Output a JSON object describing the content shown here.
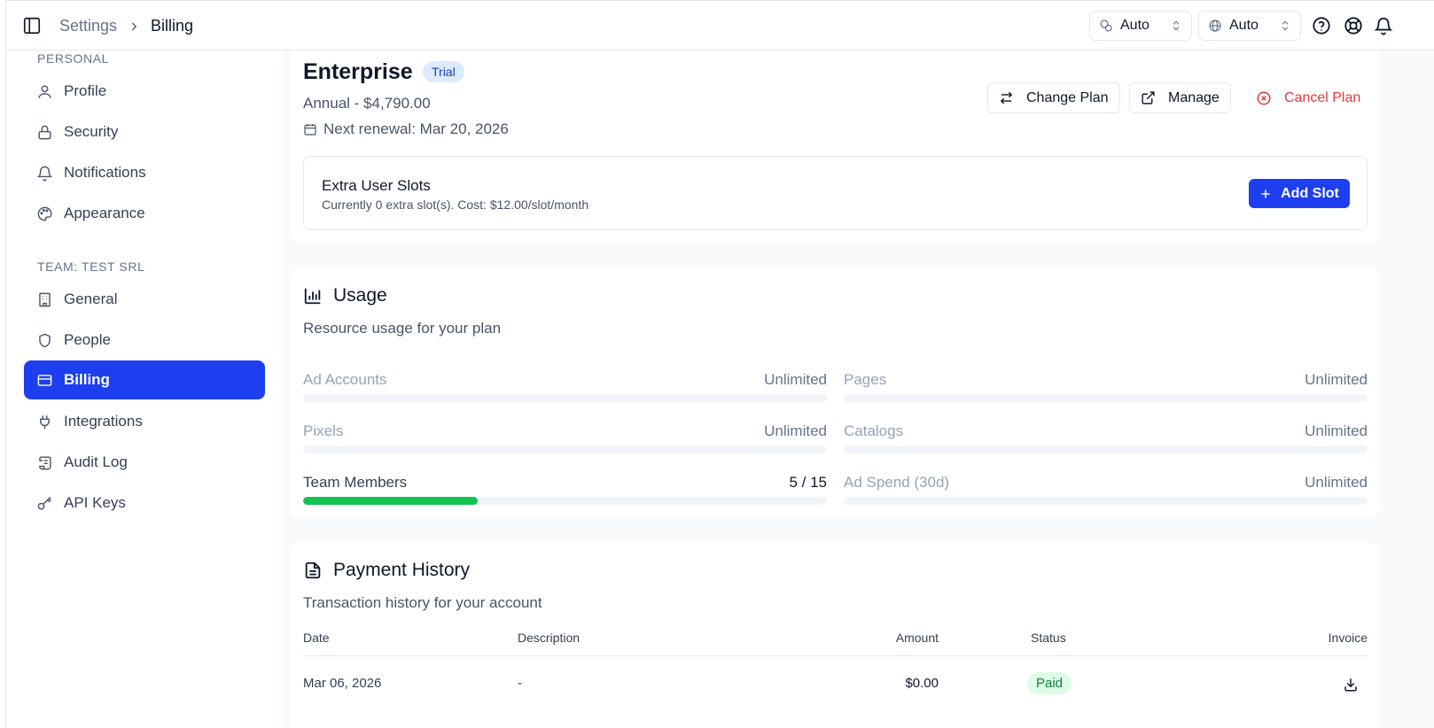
{
  "header": {
    "breadcrumb_parent": "Settings",
    "breadcrumb_current": "Billing",
    "select_1": "Auto",
    "select_2": "Auto"
  },
  "sidebar": {
    "personal_label": "PERSONAL",
    "team_label": "TEAM: TEST SRL",
    "personal_items": [
      {
        "label": "Profile",
        "icon": "user-icon"
      },
      {
        "label": "Security",
        "icon": "lock-icon"
      },
      {
        "label": "Notifications",
        "icon": "bell-icon"
      },
      {
        "label": "Appearance",
        "icon": "palette-icon"
      }
    ],
    "team_items": [
      {
        "label": "General",
        "icon": "building-icon"
      },
      {
        "label": "People",
        "icon": "shield-icon"
      },
      {
        "label": "Billing",
        "icon": "credit-card-icon",
        "active": true
      },
      {
        "label": "Integrations",
        "icon": "plug-icon"
      },
      {
        "label": "Audit Log",
        "icon": "scroll-icon"
      },
      {
        "label": "API Keys",
        "icon": "key-icon"
      }
    ]
  },
  "plan": {
    "name": "Enterprise",
    "badge": "Trial",
    "price": "Annual - $4,790.00",
    "renewal": "Next renewal: Mar 20, 2026",
    "change_plan_label": "Change Plan",
    "manage_label": "Manage",
    "cancel_label": "Cancel Plan",
    "extra_slots_title": "Extra User Slots",
    "extra_slots_desc": "Currently 0 extra slot(s). Cost: $12.00/slot/month",
    "add_slot_label": "Add Slot"
  },
  "usage": {
    "title": "Usage",
    "description": "Resource usage for your plan",
    "items": [
      {
        "label": "Ad Accounts",
        "value": "Unlimited",
        "fraction": 0
      },
      {
        "label": "Pages",
        "value": "Unlimited",
        "fraction": 0
      },
      {
        "label": "Pixels",
        "value": "Unlimited",
        "fraction": 0
      },
      {
        "label": "Catalogs",
        "value": "Unlimited",
        "fraction": 0
      },
      {
        "label": "Team Members",
        "value": "5 / 15",
        "fraction": 0.3333
      },
      {
        "label": "Ad Spend (30d)",
        "value": "Unlimited",
        "fraction": 0
      }
    ]
  },
  "payments": {
    "title": "Payment History",
    "description": "Transaction history for your account",
    "columns": [
      "Date",
      "Description",
      "Amount",
      "Status",
      "Invoice"
    ],
    "rows": [
      {
        "date": "Mar 06, 2026",
        "description": "-",
        "amount": "$0.00",
        "status": "Paid"
      }
    ]
  },
  "colors": {
    "accent": "#1d3ff0",
    "danger": "#e23b3b",
    "progress": "#12c44f",
    "paid_bg": "#dcfce7",
    "paid_text": "#15803d"
  }
}
